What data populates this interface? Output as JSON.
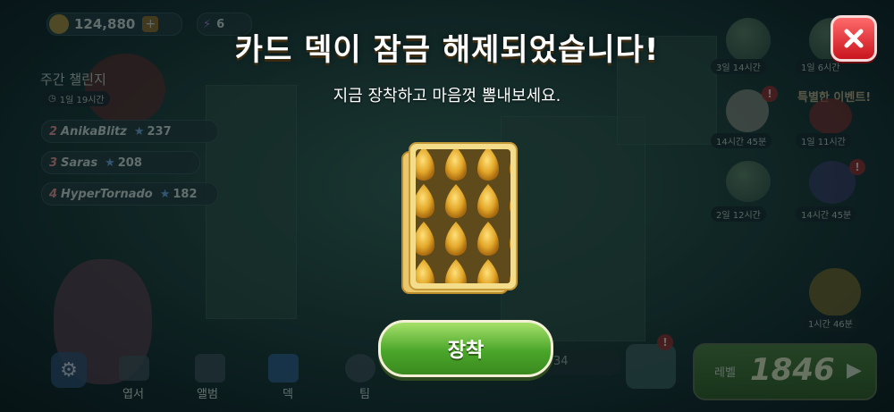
{
  "hud": {
    "coins": "124,880",
    "energy": "6",
    "weekly_challenge_label": "주간 챌린지",
    "weekly_challenge_timer": "1일 19시간"
  },
  "leaderboard": [
    {
      "rank": "2",
      "name": "AnikaBlitz",
      "stars": "237"
    },
    {
      "rank": "3",
      "name": "Saras",
      "stars": "208"
    },
    {
      "rank": "4",
      "name": "HyperTornado",
      "stars": "182"
    }
  ],
  "right_timers": [
    "3일 14시간",
    "1일 6시간",
    "14시간 45분",
    "1일 11시간",
    "2일 12시간",
    "14시간 45분",
    "1시간 46분"
  ],
  "special_event_label": "특별한 이벤트!",
  "bottom_nav": {
    "shop": "엽서",
    "album": "앨범",
    "deck": "덱",
    "team": "팀"
  },
  "level": {
    "label": "레벨",
    "value": "1846"
  },
  "progress_value": "34",
  "modal": {
    "title": "카드 덱이 잠금 해제되었습니다!",
    "subtitle": "지금 장착하고 마음껏 뽐내보세요.",
    "equip_label": "장착"
  },
  "colors": {
    "equip_green": "#4aa62a",
    "close_red": "#d9232b",
    "card_gold": "#e8b63c"
  }
}
